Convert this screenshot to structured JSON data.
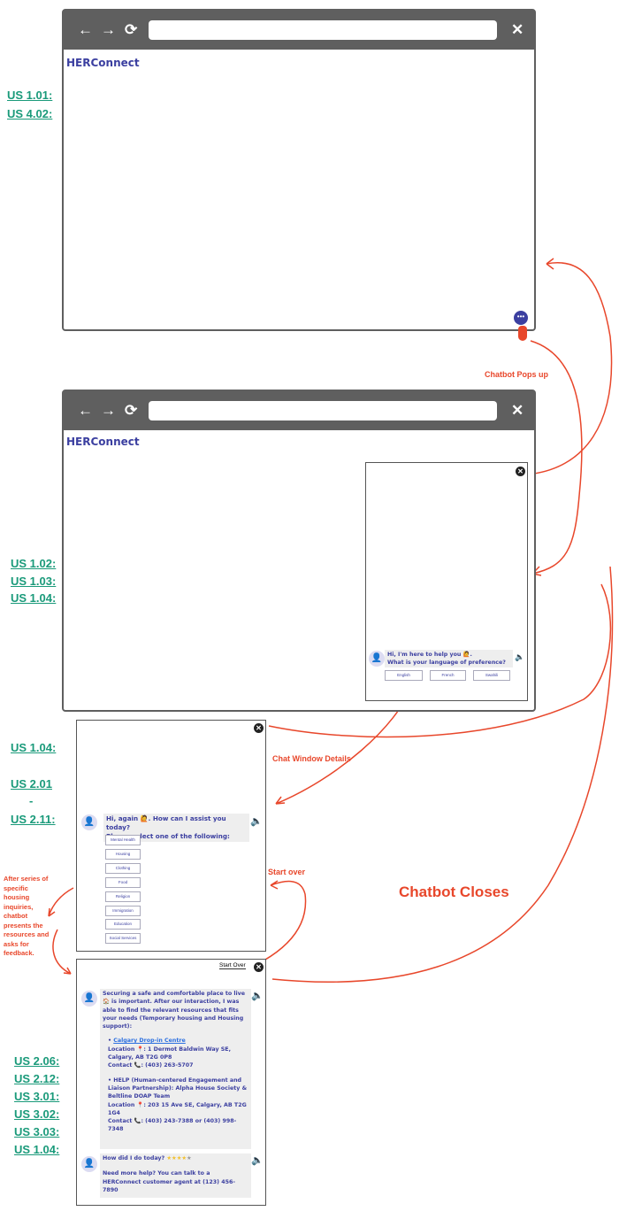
{
  "app_name": "HERConnect",
  "browser_icons": {
    "back": "←",
    "forward": "→",
    "reload": "⟳",
    "close": "✕"
  },
  "labels_screen1": [
    "US 1.01:",
    "US 4.02:"
  ],
  "labels_screen2": [
    "US 1.02:",
    "US 1.03:",
    "US 1.04:"
  ],
  "labels_screen3": [
    "US 1.04:",
    "US 2.01",
    "-",
    "US 2.11:"
  ],
  "labels_screen4": [
    "US 2.06:",
    "US 2.12:",
    "US 3.01:",
    "US 3.02:",
    "US 3.03:",
    "US 1.04:"
  ],
  "annotations": {
    "popup": "Chatbot Pops up",
    "details": "Chat Window Details",
    "start_over": "Start over",
    "closes": "Chatbot Closes",
    "side_note": "After series of specific housing inquiries, chatbot presents the resources and asks for feedback."
  },
  "chat1": {
    "greeting_line1": "Hi, I'm here to help you 🙋.",
    "greeting_line2": "What is your language of preference?",
    "languages": [
      "English",
      "French",
      "Swahili"
    ]
  },
  "chat2": {
    "line1": "Hi, again 🙋. How can I assist you today?",
    "line2": "Please select one of the following:",
    "options": [
      "Mental Health",
      "Housing",
      "Clothing",
      "Food",
      "Religion",
      "Immigration",
      "Education",
      "Social Services"
    ]
  },
  "chat3": {
    "start_over": "Start Over",
    "intro": "Securing a safe and comfortable place to live 🏠 is important. After our interaction, I was able to find the relevant resources that fits your needs (Temporary housing and Housing support):",
    "resources": [
      {
        "name": "Calgary Drop-in Centre",
        "location": "Location 📍: 1 Dermot Baldwin Way SE, Calgary, AB T2G 0P8",
        "contact": "Contact 📞: (403) 263-5707"
      },
      {
        "name": "HELP (Human-centered Engagement and Liaison Partnership): Alpha House Society & Beltline DOAP Team",
        "location": "Location 📍: 203 15 Ave SE, Calgary, AB T2G 1G4",
        "contact": "Contact 📞: (403) 243-7388 or (403) 998-7348"
      }
    ],
    "feedback_q": "How did I do today?",
    "rating": 4,
    "rating_max": 5,
    "help": "Need more help? You can talk to a HERConnect customer agent at (123) 456-7890"
  },
  "colors": {
    "brand": "#3b3fa0",
    "label": "#1a9a7a",
    "annotation": "#e8472b",
    "titlebar": "#5f5f5f"
  }
}
